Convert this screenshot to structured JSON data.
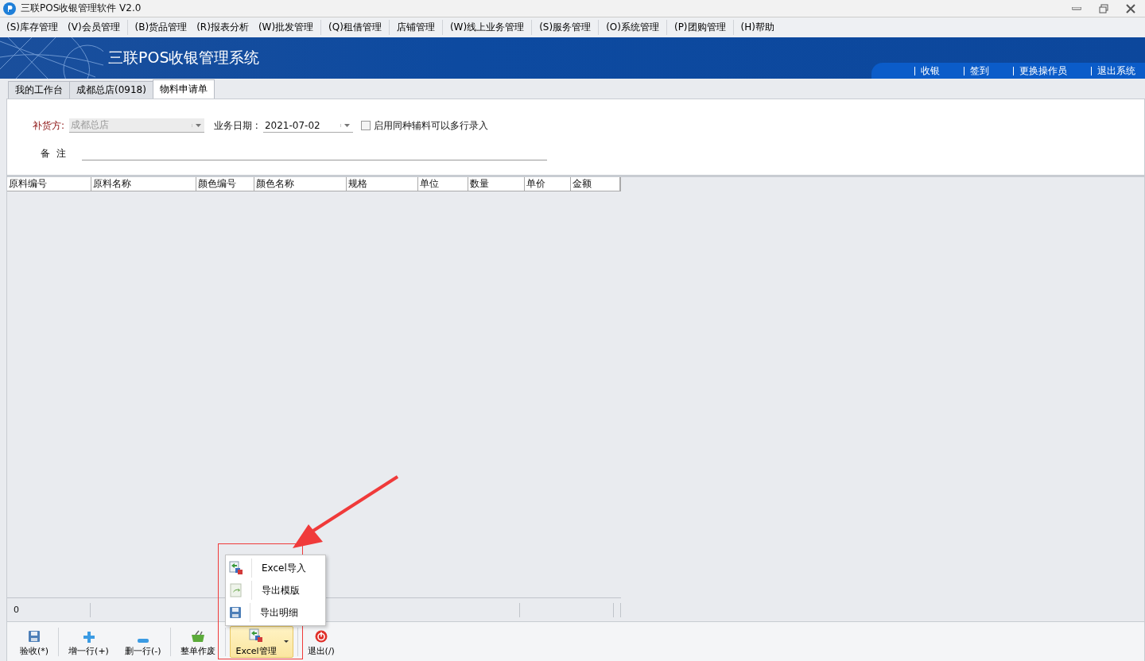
{
  "window": {
    "title": "三联POS收银管理软件 V2.0"
  },
  "menu": [
    {
      "label": "(S)库存管理",
      "separator_after": false
    },
    {
      "label": "(V)会员管理",
      "separator_after": true
    },
    {
      "label": "(B)货品管理",
      "separator_after": false
    },
    {
      "label": "(R)报表分析",
      "separator_after": false
    },
    {
      "label": "(W)批发管理",
      "separator_after": true
    },
    {
      "label": "(Q)租借管理",
      "separator_after": true
    },
    {
      "label": "店铺管理",
      "separator_after": true
    },
    {
      "label": "(W)线上业务管理",
      "separator_after": true
    },
    {
      "label": "(S)服务管理",
      "separator_after": true
    },
    {
      "label": "(O)系统管理",
      "separator_after": true
    },
    {
      "label": "(P)团购管理",
      "separator_after": true
    },
    {
      "label": "(H)帮助",
      "separator_after": false
    }
  ],
  "banner": {
    "title": "三联POS收银管理系统",
    "links": [
      "收银",
      "签到",
      "更换操作员",
      "退出系统"
    ]
  },
  "tabs": [
    {
      "label": "我的工作台",
      "selected": false
    },
    {
      "label": "成都总店(0918)",
      "selected": false
    },
    {
      "label": "物料申请单",
      "selected": true
    }
  ],
  "form": {
    "supplier_label": "补货方:",
    "supplier_value": "成都总店",
    "supplier_disabled": true,
    "date_label": "业务日期 :",
    "date_value": "2021-07-02",
    "multi_row_label": "启用同种辅料可以多行录入",
    "multi_row_checked": false,
    "note_label": "备  注"
  },
  "table": {
    "columns": [
      "原料编号",
      "原料名称",
      "颜色编号",
      "颜色名称",
      "规格",
      "单位",
      "数量",
      "单价",
      "金额"
    ],
    "footer": [
      "0"
    ]
  },
  "toolbar": [
    {
      "kind": "save",
      "label": "验收(*)",
      "active": false
    },
    {
      "kind": "add",
      "label": "增一行(+)",
      "active": false
    },
    {
      "kind": "remove",
      "label": "删一行(-)",
      "active": false
    },
    {
      "kind": "basket",
      "label": "整单作废",
      "active": false
    },
    {
      "kind": "excel",
      "label": "Excel管理",
      "active": true,
      "dropdown": true
    },
    {
      "kind": "exit",
      "label": "退出(/)",
      "active": false
    }
  ],
  "dropdown_menu": [
    {
      "kind": "import",
      "label": "Excel导入"
    },
    {
      "kind": "template",
      "label": "导出模版"
    },
    {
      "kind": "save",
      "label": "导出明细"
    }
  ]
}
